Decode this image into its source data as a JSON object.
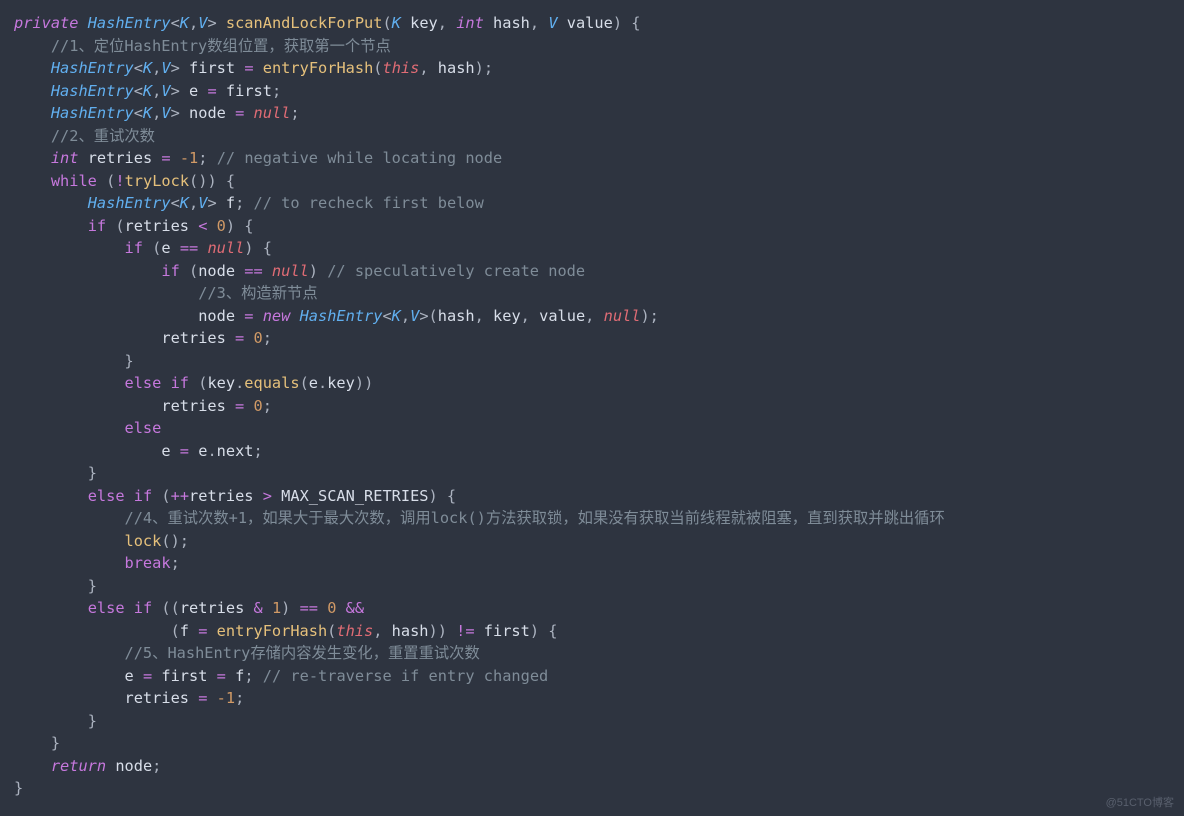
{
  "watermark": "@51CTO博客",
  "code": {
    "l1": {
      "a": "private",
      "b": "HashEntry",
      "c": "K",
      "d": "V",
      "e": "scanAndLockForPut",
      "f": "K",
      "g": "key",
      "h": "int",
      "i": "hash",
      "j": "V",
      "k": "value"
    },
    "l2": {
      "a": "//1、定位HashEntry数组位置，获取第一个节点"
    },
    "l3": {
      "a": "HashEntry",
      "b": "K",
      "c": "V",
      "d": "first",
      "e": "entryForHash",
      "f": "this",
      "g": "hash"
    },
    "l4": {
      "a": "HashEntry",
      "b": "K",
      "c": "V",
      "d": "e",
      "e": "first"
    },
    "l5": {
      "a": "HashEntry",
      "b": "K",
      "c": "V",
      "d": "node",
      "e": "null"
    },
    "l6": {
      "a": "//2、重试次数"
    },
    "l7": {
      "a": "int",
      "b": "retries",
      "c": "-1",
      "d": "// negative while locating node"
    },
    "l8": {
      "a": "while",
      "b": "tryLock"
    },
    "l9": {
      "a": "HashEntry",
      "b": "K",
      "c": "V",
      "d": "f",
      "e": "// to recheck first below"
    },
    "l10": {
      "a": "if",
      "b": "retries",
      "c": "0"
    },
    "l11": {
      "a": "if",
      "b": "e",
      "c": "null"
    },
    "l12": {
      "a": "if",
      "b": "node",
      "c": "null",
      "d": "// speculatively create node"
    },
    "l13": {
      "a": "//3、构造新节点"
    },
    "l14": {
      "a": "node",
      "b": "new",
      "c": "HashEntry",
      "d": "K",
      "e": "V",
      "f": "hash",
      "g": "key",
      "h": "value",
      "i": "null"
    },
    "l15": {
      "a": "retries",
      "b": "0"
    },
    "l17": {
      "a": "else",
      "b": "if",
      "c": "key",
      "d": "equals",
      "e": "e",
      "f": "key"
    },
    "l18": {
      "a": "retries",
      "b": "0"
    },
    "l19": {
      "a": "else"
    },
    "l20": {
      "a": "e",
      "b": "e",
      "c": "next"
    },
    "l22": {
      "a": "else",
      "b": "if",
      "c": "retries",
      "d": "MAX_SCAN_RETRIES"
    },
    "l23": {
      "a": "//4、重试次数+1，如果大于最大次数，调用lock()方法获取锁，如果没有获取当前线程就被阻塞，直到获取并跳出循环"
    },
    "l24": {
      "a": "lock"
    },
    "l25": {
      "a": "break"
    },
    "l27": {
      "a": "else",
      "b": "if",
      "c": "retries",
      "d": "1",
      "e": "0"
    },
    "l28": {
      "a": "f",
      "b": "entryForHash",
      "c": "this",
      "d": "hash",
      "e": "first"
    },
    "l29": {
      "a": "//5、HashEntry存储内容发生变化，重置重试次数"
    },
    "l30": {
      "a": "e",
      "b": "first",
      "c": "f",
      "d": "// re-traverse if entry changed"
    },
    "l31": {
      "a": "retries",
      "b": "-1"
    },
    "l34": {
      "a": "return",
      "b": "node"
    }
  }
}
